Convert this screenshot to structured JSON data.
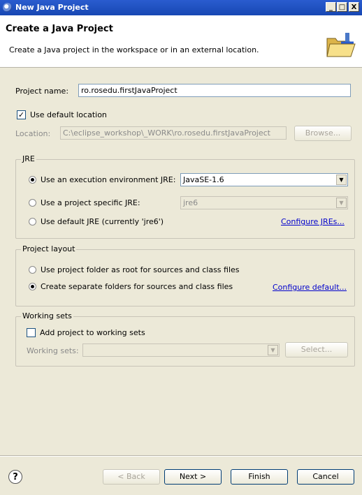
{
  "window": {
    "title": "New Java Project"
  },
  "title_buttons": {
    "minimize": "_",
    "maximize": "□",
    "close": "X"
  },
  "header": {
    "title": "Create a Java Project",
    "description": "Create a Java project in the workspace or in an external location."
  },
  "project_name": {
    "label": "Project name:",
    "value": "ro.rosedu.firstJavaProject"
  },
  "default_location": {
    "label": "Use default location",
    "checked": true
  },
  "location": {
    "label": "Location:",
    "value": "C:\\eclipse_workshop\\_WORK\\ro.rosedu.firstJavaProject",
    "browse_label": "Browse..."
  },
  "jre": {
    "group_title": "JRE",
    "option_env": "Use an execution environment JRE:",
    "env_value": "JavaSE-1.6",
    "option_specific": "Use a project specific JRE:",
    "specific_value": "jre6",
    "option_default": "Use default JRE (currently 'jre6')",
    "configure_link": "Configure JREs..."
  },
  "layout": {
    "group_title": "Project layout",
    "option_root": "Use project folder as root for sources and class files",
    "option_separate": "Create separate folders for sources and class files",
    "configure_link": "Configure default..."
  },
  "working_sets": {
    "group_title": "Working sets",
    "add_label": "Add project to working sets",
    "sets_label": "Working sets:",
    "select_label": "Select..."
  },
  "footer": {
    "help": "?",
    "back_label": "< Back",
    "next_label": "Next >",
    "finish_label": "Finish",
    "cancel_label": "Cancel"
  }
}
